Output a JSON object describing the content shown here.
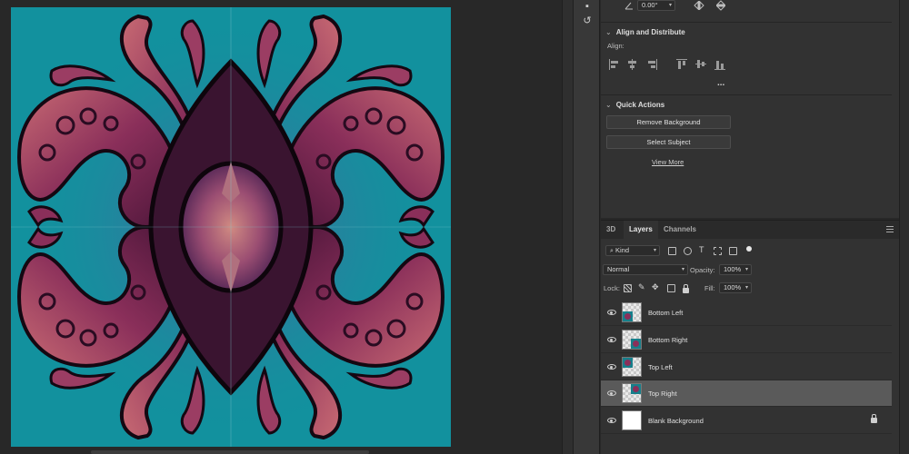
{
  "properties": {
    "rotation_value": "0.00°",
    "align_distribute": {
      "title": "Align and Distribute",
      "align_label": "Align:",
      "icons": [
        "align-left-edges-icon",
        "align-horizontal-centers-icon",
        "align-right-edges-icon",
        "align-top-edges-icon",
        "align-vertical-centers-icon",
        "align-bottom-edges-icon"
      ],
      "more_label": "..."
    },
    "quick_actions": {
      "title": "Quick Actions",
      "remove_background": "Remove Background",
      "select_subject": "Select Subject",
      "view_more": "View More"
    }
  },
  "layers_panel": {
    "tabs": [
      "3D",
      "Layers",
      "Channels"
    ],
    "active_tab": "Layers",
    "filter_kind": "Kind",
    "blend_mode": "Normal",
    "opacity_label": "Opacity:",
    "opacity_value": "100%",
    "lock_label": "Lock:",
    "fill_label": "Fill:",
    "fill_value": "100%",
    "layers": [
      {
        "name": "Bottom Left",
        "selected": false,
        "locked": false
      },
      {
        "name": "Bottom Right",
        "selected": false,
        "locked": false
      },
      {
        "name": "Top Left",
        "selected": false,
        "locked": false
      },
      {
        "name": "Top Right",
        "selected": true,
        "locked": false
      },
      {
        "name": "Blank Background",
        "selected": false,
        "locked": true
      }
    ]
  },
  "colors": {
    "canvas_background": "#12919e",
    "tentacle_dark": "#5a1b3a",
    "tentacle_mid": "#8a2f5a",
    "tentacle_light": "#c86a73",
    "panel_bg": "#323232",
    "selected_row": "#5a5a5a"
  }
}
